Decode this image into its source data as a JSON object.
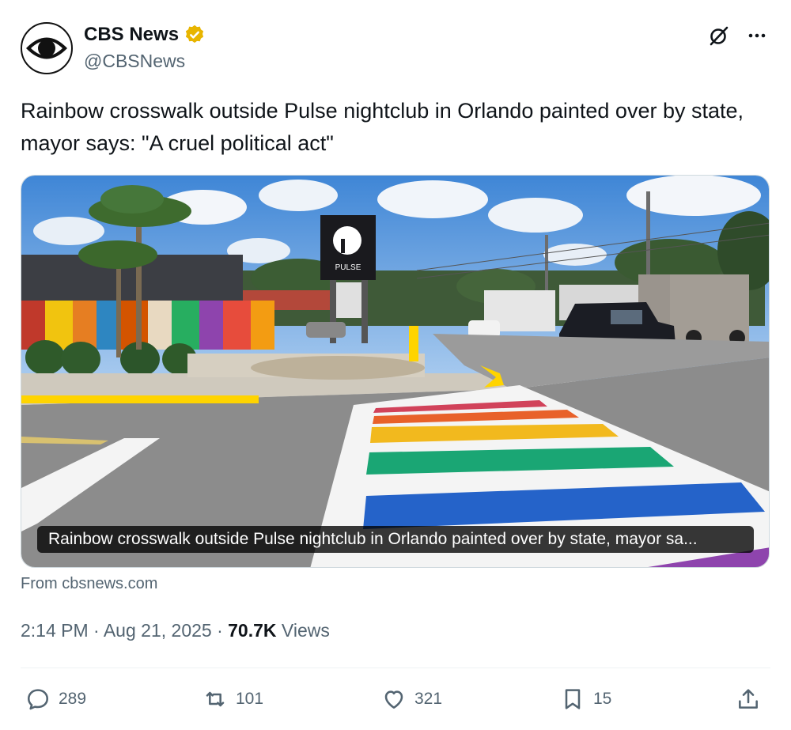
{
  "author": {
    "name": "CBS News",
    "handle": "@CBSNews",
    "avatar_icon": "cbs-eye-logo",
    "verified_badge_color": "#e8b500"
  },
  "tweet": {
    "text": "Rainbow crosswalk outside Pulse nightclub in Orlando painted over by state, mayor says: \"A cruel political act\""
  },
  "media": {
    "caption": "Rainbow crosswalk outside Pulse nightclub in Orlando painted over by state, mayor sa...",
    "sign_text": "PULSE"
  },
  "link_source": "From cbsnews.com",
  "meta": {
    "time": "2:14 PM",
    "separator": "·",
    "date": "Aug 21, 2025",
    "views_count": "70.7K",
    "views_label": "Views"
  },
  "actions": {
    "replies": "289",
    "reposts": "101",
    "likes": "321",
    "bookmarks": "15"
  },
  "colors": {
    "text_primary": "#0f1419",
    "text_secondary": "#536471"
  }
}
